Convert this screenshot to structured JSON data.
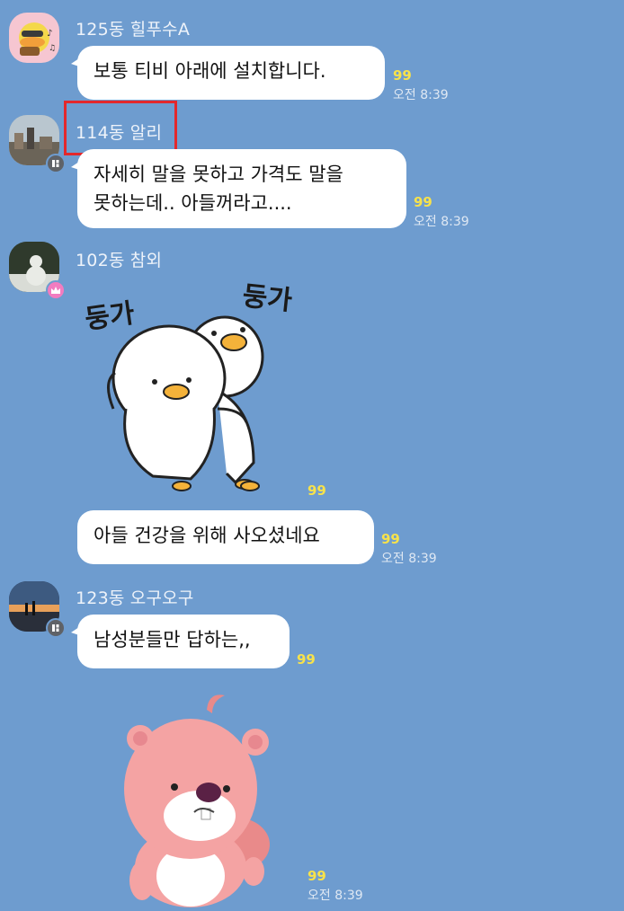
{
  "messages": [
    {
      "sender": "125동 힐푸수A",
      "text": "보통 티비 아래에 설치합니다.",
      "unread": "99",
      "time": "오전 8:39"
    },
    {
      "sender": "114동 알리",
      "text_line1": "자세히 말을 못하고 가격도 말을",
      "text_line2": "못하는데..  아들꺼라고....",
      "unread": "99",
      "time": "오전 8:39"
    },
    {
      "sender": "102동 참외",
      "sticker_text_left": "둥가",
      "sticker_text_right": "둥가",
      "unread_sticker": "99",
      "text": "아들 건강을 위해 사오셨네요",
      "unread": "99",
      "time": "오전 8:39"
    },
    {
      "sender": "123동 오구오구",
      "text": "남성분들만 답하는,,",
      "unread": "99",
      "unread_sticker": "99",
      "time_sticker": "오전 8:39"
    }
  ],
  "colors": {
    "background": "#6e9ccf",
    "bubble": "#ffffff",
    "unread": "#f7e24b",
    "highlight": "#e3282c"
  }
}
